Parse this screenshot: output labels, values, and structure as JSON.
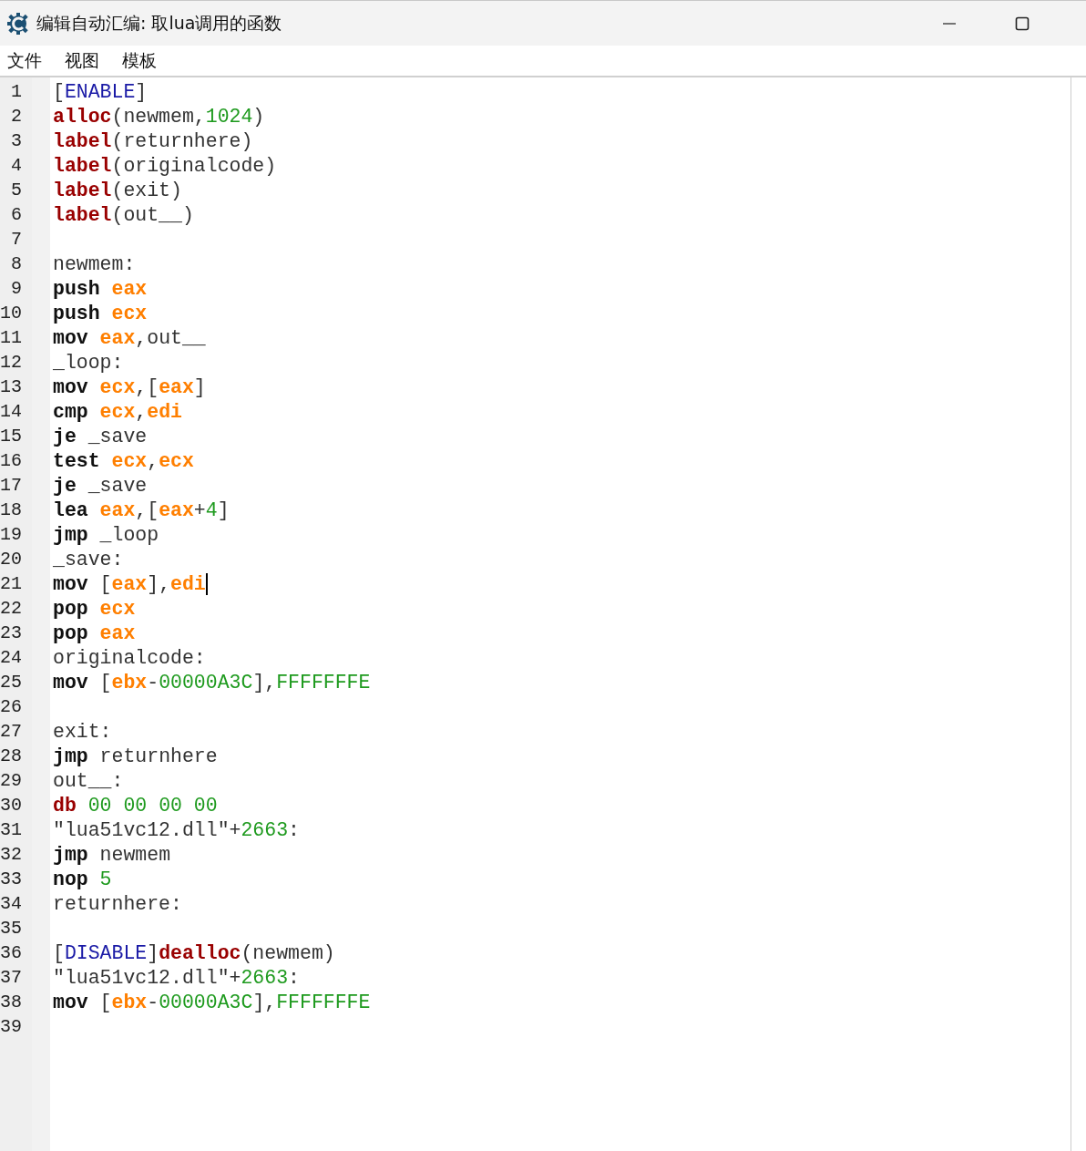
{
  "window": {
    "title": "编辑自动汇编: 取lua调用的函数"
  },
  "menu": [
    {
      "label": "文件"
    },
    {
      "label": "视图"
    },
    {
      "label": "模板"
    }
  ],
  "editor": {
    "lines": [
      {
        "number": "1",
        "caret": false,
        "tokens": [
          {
            "kind": "p",
            "t": "["
          },
          {
            "kind": "sec",
            "t": "ENABLE"
          },
          {
            "kind": "p",
            "t": "]"
          }
        ]
      },
      {
        "number": "2",
        "caret": false,
        "tokens": [
          {
            "kind": "kw",
            "t": "alloc"
          },
          {
            "kind": "p",
            "t": "(newmem,"
          },
          {
            "kind": "num",
            "t": "1024"
          },
          {
            "kind": "p",
            "t": ")"
          }
        ]
      },
      {
        "number": "3",
        "caret": false,
        "tokens": [
          {
            "kind": "kw",
            "t": "label"
          },
          {
            "kind": "p",
            "t": "(returnhere)"
          }
        ]
      },
      {
        "number": "4",
        "caret": false,
        "tokens": [
          {
            "kind": "kw",
            "t": "label"
          },
          {
            "kind": "p",
            "t": "(originalcode)"
          }
        ]
      },
      {
        "number": "5",
        "caret": false,
        "tokens": [
          {
            "kind": "kw",
            "t": "label"
          },
          {
            "kind": "p",
            "t": "(exit)"
          }
        ]
      },
      {
        "number": "6",
        "caret": false,
        "tokens": [
          {
            "kind": "kw",
            "t": "label"
          },
          {
            "kind": "p",
            "t": "(out__)"
          }
        ]
      },
      {
        "number": "7",
        "caret": false
      },
      {
        "number": "8",
        "caret": false,
        "tokens": [
          {
            "kind": "p",
            "t": "newmem:"
          }
        ]
      },
      {
        "number": "9",
        "caret": false,
        "tokens": [
          {
            "kind": "op",
            "t": "push "
          },
          {
            "kind": "reg",
            "t": "eax"
          }
        ]
      },
      {
        "number": "10",
        "caret": false,
        "tokens": [
          {
            "kind": "op",
            "t": "push "
          },
          {
            "kind": "reg",
            "t": "ecx"
          }
        ]
      },
      {
        "number": "11",
        "caret": false,
        "tokens": [
          {
            "kind": "op",
            "t": "mov "
          },
          {
            "kind": "reg",
            "t": "eax"
          },
          {
            "kind": "p",
            "t": ",out__"
          }
        ]
      },
      {
        "number": "12",
        "caret": false,
        "tokens": [
          {
            "kind": "p",
            "t": "_loop:"
          }
        ]
      },
      {
        "number": "13",
        "caret": false,
        "tokens": [
          {
            "kind": "op",
            "t": "mov "
          },
          {
            "kind": "reg",
            "t": "ecx"
          },
          {
            "kind": "p",
            "t": ",["
          },
          {
            "kind": "reg",
            "t": "eax"
          },
          {
            "kind": "p",
            "t": "]"
          }
        ]
      },
      {
        "number": "14",
        "caret": false,
        "tokens": [
          {
            "kind": "op",
            "t": "cmp "
          },
          {
            "kind": "reg",
            "t": "ecx"
          },
          {
            "kind": "p",
            "t": ","
          },
          {
            "kind": "reg",
            "t": "edi"
          }
        ]
      },
      {
        "number": "15",
        "caret": false,
        "tokens": [
          {
            "kind": "op",
            "t": "je"
          },
          {
            "kind": "p",
            "t": " _save"
          }
        ]
      },
      {
        "number": "16",
        "caret": false,
        "tokens": [
          {
            "kind": "op",
            "t": "test "
          },
          {
            "kind": "reg",
            "t": "ecx"
          },
          {
            "kind": "p",
            "t": ","
          },
          {
            "kind": "reg",
            "t": "ecx"
          }
        ]
      },
      {
        "number": "17",
        "caret": false,
        "tokens": [
          {
            "kind": "op",
            "t": "je"
          },
          {
            "kind": "p",
            "t": " _save"
          }
        ]
      },
      {
        "number": "18",
        "caret": false,
        "tokens": [
          {
            "kind": "op",
            "t": "lea "
          },
          {
            "kind": "reg",
            "t": "eax"
          },
          {
            "kind": "p",
            "t": ",["
          },
          {
            "kind": "reg",
            "t": "eax"
          },
          {
            "kind": "p",
            "t": "+"
          },
          {
            "kind": "num",
            "t": "4"
          },
          {
            "kind": "p",
            "t": "]"
          }
        ]
      },
      {
        "number": "19",
        "caret": false,
        "tokens": [
          {
            "kind": "op",
            "t": "jmp"
          },
          {
            "kind": "p",
            "t": " _loop"
          }
        ]
      },
      {
        "number": "20",
        "caret": false,
        "tokens": [
          {
            "kind": "p",
            "t": "_save:"
          }
        ]
      },
      {
        "number": "21",
        "caret": true,
        "tokens": [
          {
            "kind": "op",
            "t": "mov"
          },
          {
            "kind": "p",
            "t": " ["
          },
          {
            "kind": "reg",
            "t": "eax"
          },
          {
            "kind": "p",
            "t": "],"
          },
          {
            "kind": "reg",
            "t": "edi"
          }
        ]
      },
      {
        "number": "22",
        "caret": false,
        "tokens": [
          {
            "kind": "op",
            "t": "pop "
          },
          {
            "kind": "reg",
            "t": "ecx"
          }
        ]
      },
      {
        "number": "23",
        "caret": false,
        "tokens": [
          {
            "kind": "op",
            "t": "pop "
          },
          {
            "kind": "reg",
            "t": "eax"
          }
        ]
      },
      {
        "number": "24",
        "caret": false,
        "tokens": [
          {
            "kind": "p",
            "t": "originalcode:"
          }
        ]
      },
      {
        "number": "25",
        "caret": false,
        "tokens": [
          {
            "kind": "op",
            "t": "mov"
          },
          {
            "kind": "p",
            "t": " ["
          },
          {
            "kind": "reg",
            "t": "ebx"
          },
          {
            "kind": "p",
            "t": "-"
          },
          {
            "kind": "num",
            "t": "00000A3C"
          },
          {
            "kind": "p",
            "t": "],"
          },
          {
            "kind": "num",
            "t": "FFFFFFFE"
          }
        ]
      },
      {
        "number": "26",
        "caret": false
      },
      {
        "number": "27",
        "caret": false,
        "tokens": [
          {
            "kind": "p",
            "t": "exit:"
          }
        ]
      },
      {
        "number": "28",
        "caret": false,
        "tokens": [
          {
            "kind": "op",
            "t": "jmp"
          },
          {
            "kind": "p",
            "t": " returnhere"
          }
        ]
      },
      {
        "number": "29",
        "caret": false,
        "tokens": [
          {
            "kind": "p",
            "t": "out__:"
          }
        ]
      },
      {
        "number": "30",
        "caret": false,
        "tokens": [
          {
            "kind": "kw",
            "t": "db "
          },
          {
            "kind": "num",
            "t": "00 00 00 00"
          }
        ]
      },
      {
        "number": "31",
        "caret": false,
        "tokens": [
          {
            "kind": "p",
            "t": "\"lua51vc12.dll\"+"
          },
          {
            "kind": "num",
            "t": "2663"
          },
          {
            "kind": "p",
            "t": ":"
          }
        ]
      },
      {
        "number": "32",
        "caret": false,
        "tokens": [
          {
            "kind": "op",
            "t": "jmp"
          },
          {
            "kind": "p",
            "t": " newmem"
          }
        ]
      },
      {
        "number": "33",
        "caret": false,
        "tokens": [
          {
            "kind": "op",
            "t": "nop "
          },
          {
            "kind": "num",
            "t": "5"
          }
        ]
      },
      {
        "number": "34",
        "caret": false,
        "tokens": [
          {
            "kind": "p",
            "t": "returnhere:"
          }
        ]
      },
      {
        "number": "35",
        "caret": false
      },
      {
        "number": "36",
        "caret": false,
        "tokens": [
          {
            "kind": "p",
            "t": "["
          },
          {
            "kind": "sec",
            "t": "DISABLE"
          },
          {
            "kind": "p",
            "t": "]"
          },
          {
            "kind": "kw",
            "t": "dealloc"
          },
          {
            "kind": "p",
            "t": "(newmem)"
          }
        ]
      },
      {
        "number": "37",
        "caret": false,
        "tokens": [
          {
            "kind": "p",
            "t": "\"lua51vc12.dll\"+"
          },
          {
            "kind": "num",
            "t": "2663"
          },
          {
            "kind": "p",
            "t": ":"
          }
        ]
      },
      {
        "number": "38",
        "caret": false,
        "tokens": [
          {
            "kind": "op",
            "t": "mov"
          },
          {
            "kind": "p",
            "t": " ["
          },
          {
            "kind": "reg",
            "t": "ebx"
          },
          {
            "kind": "p",
            "t": "-"
          },
          {
            "kind": "num",
            "t": "00000A3C"
          },
          {
            "kind": "p",
            "t": "],"
          },
          {
            "kind": "num",
            "t": "FFFFFFFE"
          }
        ]
      },
      {
        "number": "39",
        "caret": false
      }
    ]
  }
}
